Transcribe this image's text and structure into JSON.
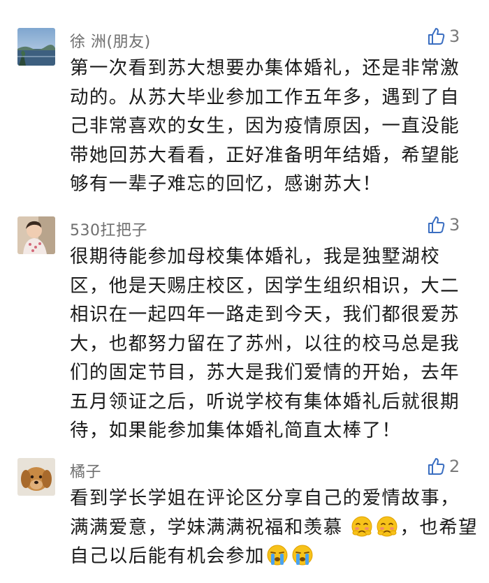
{
  "comments": [
    {
      "name": "徐 洲(朋友)",
      "likes": "3",
      "avatar_icon": "landscape-photo-avatar",
      "text": "第一次看到苏大想要办集体婚礼，还是非常激动的。从苏大毕业参加工作五年多，遇到了自己非常喜欢的女生，因为疫情原因，一直没能带她回苏大看看，正好准备明年结婚，希望能够有一辈子难忘的回忆，感谢苏大！"
    },
    {
      "name": "530扛把子",
      "likes": "3",
      "avatar_icon": "baby-photo-avatar",
      "text": "很期待能参加母校集体婚礼，我是独墅湖校区，他是天赐庄校区，因学生组织相识，大二相识在一起四年一路走到今天，我们都很爱苏大，也都努力留在了苏州，以往的校马总是我们的固定节目，苏大是我们爱情的开始，去年五月领证之后，听说学校有集体婚礼后就很期待，如果能参加集体婚礼简直太棒了！"
    },
    {
      "name": "橘子",
      "likes": "2",
      "avatar_icon": "dog-photo-avatar",
      "text_part1": "看到学长学姐在评论区分享自己的爱情故事，满满爱意，学妹满满祝福和羡慕",
      "text_part2": "，也希望自己以后能有机会参加",
      "emoji_1": "blushing-face-emoji",
      "emoji_2": "crying-face-emoji"
    }
  ],
  "colors": {
    "name": "#6f6f6f",
    "body_text": "#1a1a1a",
    "like_icon": "#3a6ec1",
    "emoji_yellow": "#f7c21a"
  }
}
